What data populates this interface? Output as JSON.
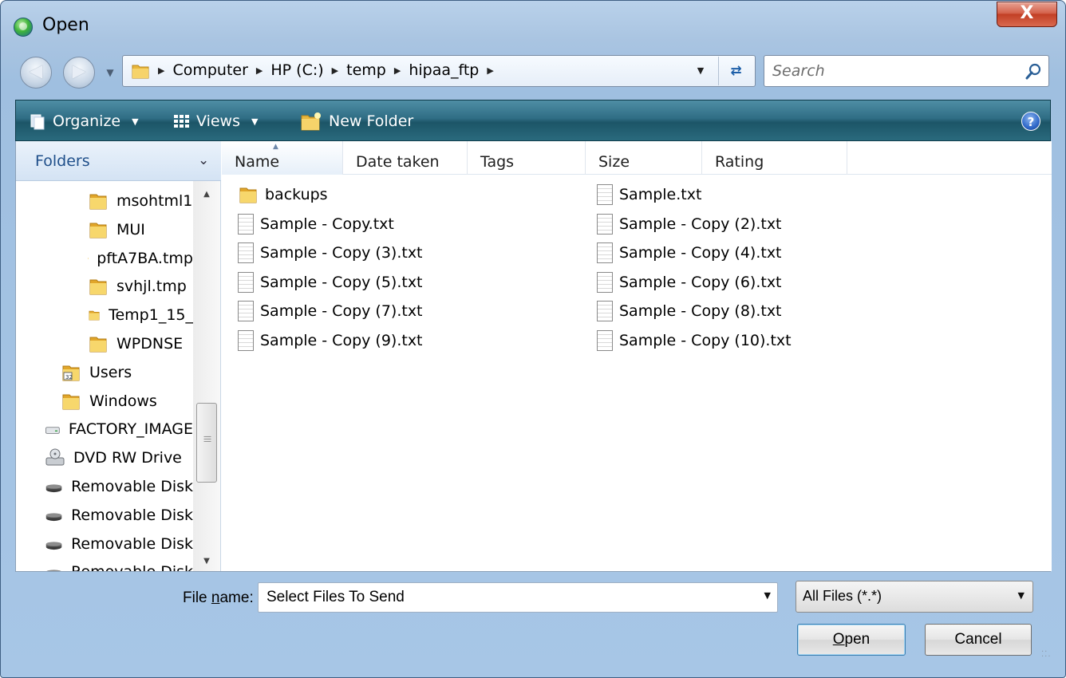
{
  "window": {
    "title": "Open",
    "close_label": "X"
  },
  "address": {
    "crumbs": [
      "Computer",
      "HP (C:)",
      "temp",
      "hipaa_ftp"
    ],
    "search_placeholder": "Search"
  },
  "commands": {
    "organize": "Organize",
    "views": "Views",
    "new_folder": "New Folder"
  },
  "folders_pane": {
    "title": "Folders",
    "items": [
      {
        "label": "msohtml1",
        "icon": "folder-icon"
      },
      {
        "label": "MUI",
        "icon": "folder-icon"
      },
      {
        "label": "pftA7BA.tmp",
        "icon": "folder-icon"
      },
      {
        "label": "svhjl.tmp",
        "icon": "folder-icon"
      },
      {
        "label": "Temp1_15_",
        "icon": "folder-icon"
      },
      {
        "label": "WPDNSE",
        "icon": "folder-icon"
      },
      {
        "label": "Users",
        "icon": "users-folder-icon"
      },
      {
        "label": "Windows",
        "icon": "folder-icon"
      },
      {
        "label": "FACTORY_IMAGE",
        "icon": "hard-drive-icon"
      },
      {
        "label": "DVD RW Drive",
        "icon": "dvd-drive-icon"
      },
      {
        "label": "Removable Disk",
        "icon": "removable-disk-icon"
      },
      {
        "label": "Removable Disk",
        "icon": "removable-disk-icon"
      },
      {
        "label": "Removable Disk",
        "icon": "removable-disk-icon"
      },
      {
        "label": "Removable Disk",
        "icon": "removable-disk-icon"
      }
    ]
  },
  "columns": [
    "Name",
    "Date taken",
    "Tags",
    "Size",
    "Rating"
  ],
  "files": [
    {
      "name": "backups",
      "type": "folder"
    },
    {
      "name": "Sample.txt",
      "type": "text"
    },
    {
      "name": "Sample - Copy.txt",
      "type": "text"
    },
    {
      "name": "Sample - Copy (2).txt",
      "type": "text"
    },
    {
      "name": "Sample - Copy (3).txt",
      "type": "text"
    },
    {
      "name": "Sample - Copy (4).txt",
      "type": "text"
    },
    {
      "name": "Sample - Copy (5).txt",
      "type": "text"
    },
    {
      "name": "Sample - Copy (6).txt",
      "type": "text"
    },
    {
      "name": "Sample - Copy (7).txt",
      "type": "text"
    },
    {
      "name": "Sample - Copy (8).txt",
      "type": "text"
    },
    {
      "name": "Sample - Copy (9).txt",
      "type": "text"
    },
    {
      "name": "Sample - Copy (10).txt",
      "type": "text"
    }
  ],
  "bottom": {
    "filename_label_prefix": "File ",
    "filename_label_accel": "n",
    "filename_label_suffix": "ame:",
    "filename_value": "Select Files To Send",
    "filetype_value": "All Files (*.*)",
    "open_accel": "O",
    "open_rest": "pen",
    "cancel_label": "Cancel"
  }
}
